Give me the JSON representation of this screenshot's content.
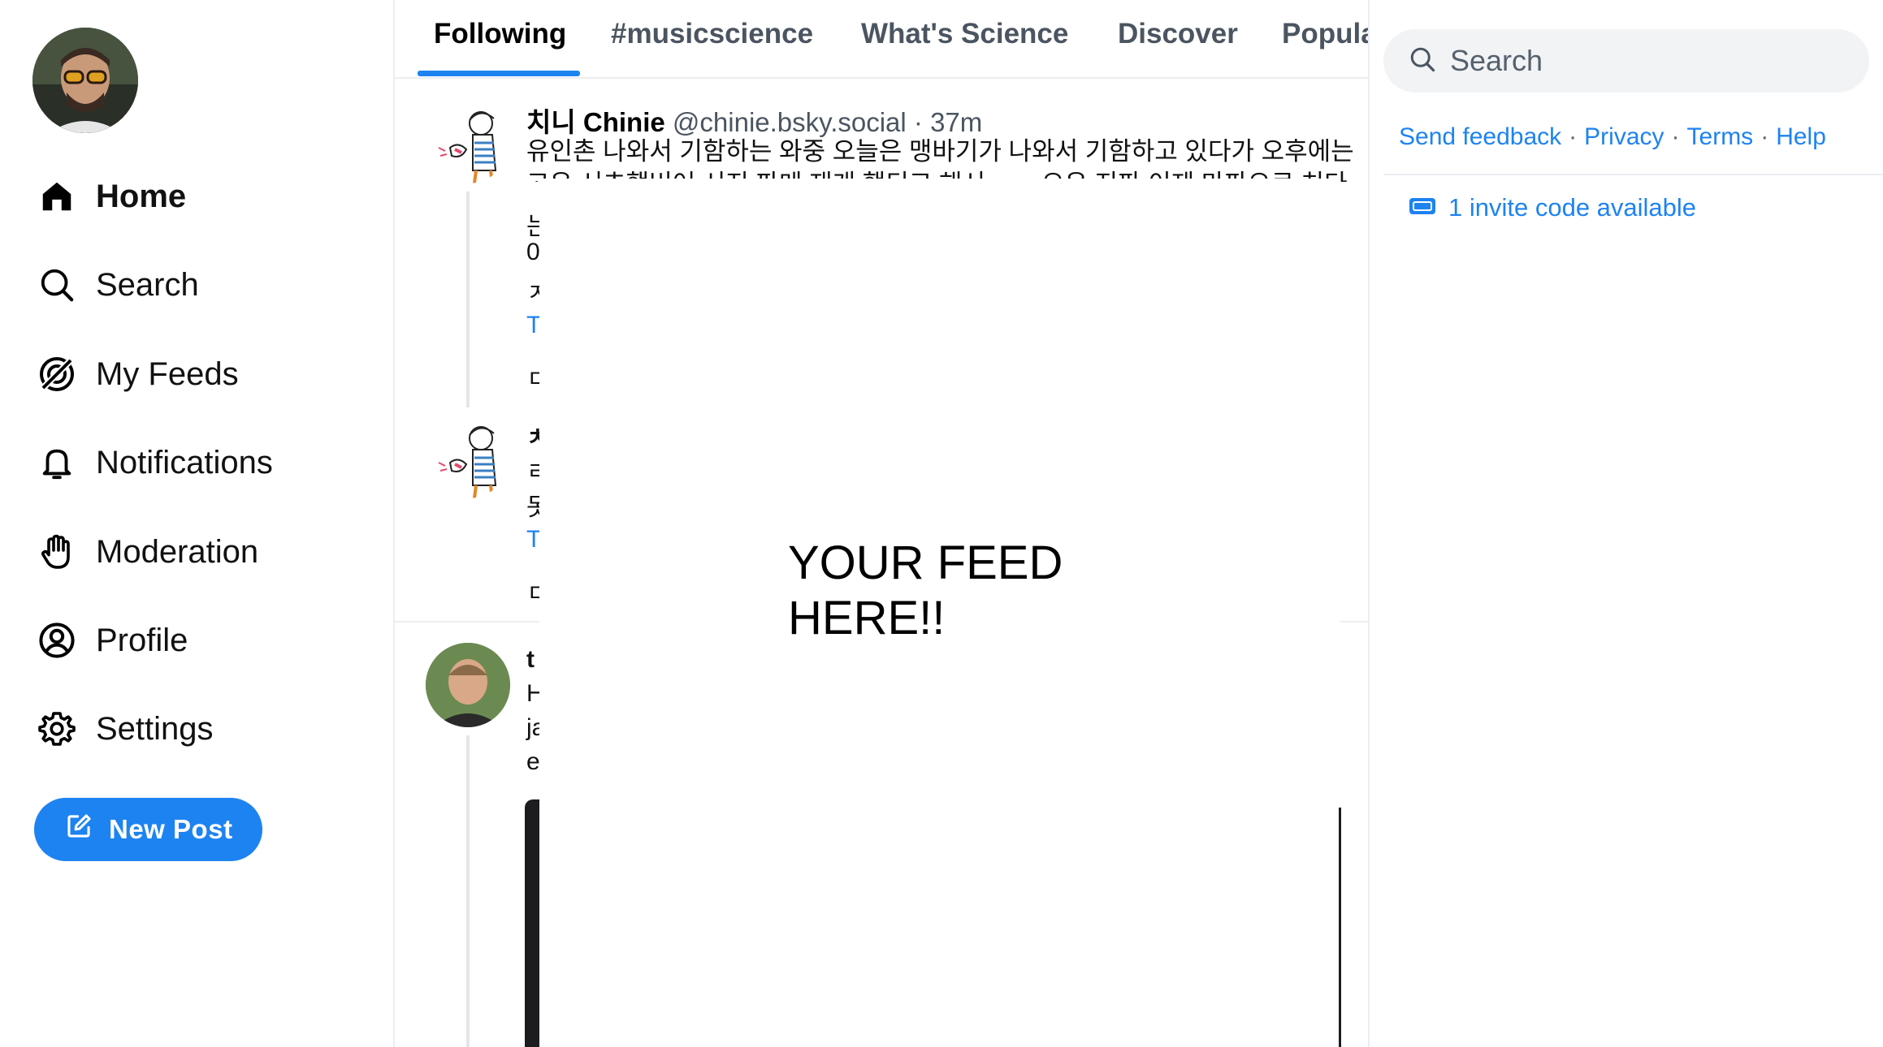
{
  "nav": {
    "items": [
      {
        "label": "Home",
        "icon": "home-icon",
        "active": true
      },
      {
        "label": "Search",
        "icon": "search-icon",
        "active": false
      },
      {
        "label": "My Feeds",
        "icon": "feeds-icon",
        "active": false
      },
      {
        "label": "Notifications",
        "icon": "bell-icon",
        "active": false
      },
      {
        "label": "Moderation",
        "icon": "hand-icon",
        "active": false
      },
      {
        "label": "Profile",
        "icon": "user-circle-icon",
        "active": false
      },
      {
        "label": "Settings",
        "icon": "gear-icon",
        "active": false
      }
    ],
    "new_post_label": "New Post"
  },
  "tabs": [
    {
      "label": "Following",
      "active": true
    },
    {
      "label": "#musicscience",
      "active": false
    },
    {
      "label": "What's Science",
      "active": false
    },
    {
      "label": "Discover",
      "active": false
    },
    {
      "label": "Popula",
      "active": false
    }
  ],
  "posts": [
    {
      "display_name": "치니 Chinie",
      "handle": "@chinie.bsky.social",
      "time": "· 37m",
      "text_line1": "유인촌 나와서 기함하는 와중 오늘은 맹바기가 나와서 기함하고 있다가 오후에는",
      "text_line2_partial": "고우 서초했버어 시지 파메 재개 했디고 해서 ...... 으우 지파 이제 마파으로 치다",
      "clipped_chars": [
        "는",
        "0",
        "ㅈ",
        "T",
        "ㄷ"
      ]
    },
    {
      "clipped_chars": [
        "ㅊ",
        "ㄹ",
        "돗",
        "T",
        "ㄷ"
      ]
    },
    {
      "clipped_chars": [
        "t",
        "H",
        "ja",
        "e"
      ]
    }
  ],
  "overlay": {
    "line1": "YOUR FEED",
    "line2": "HERE!!"
  },
  "search": {
    "placeholder": "Search"
  },
  "footer": {
    "feedback": "Send feedback",
    "privacy": "Privacy",
    "terms": "Terms",
    "help": "Help",
    "dot": "·"
  },
  "invite": {
    "label": "1 invite code available"
  },
  "colors": {
    "accent": "#1d83f1",
    "border": "#eceef1",
    "muted": "#4b5561"
  }
}
